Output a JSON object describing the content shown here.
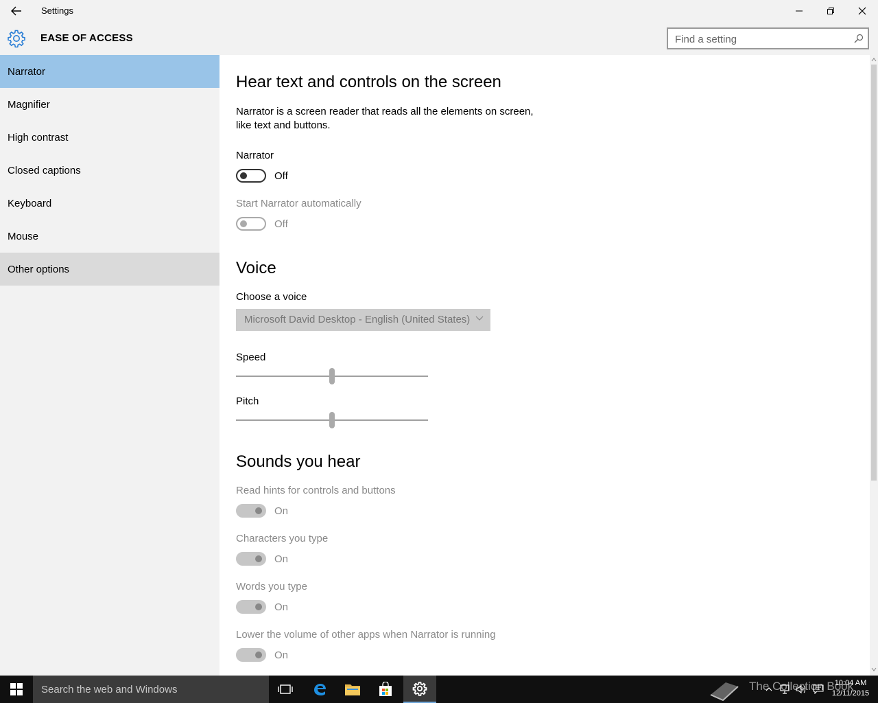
{
  "window": {
    "title": "Settings",
    "back_icon": "back-arrow-icon",
    "minimize_icon": "minimize-icon",
    "restore_icon": "restore-icon",
    "close_icon": "close-icon"
  },
  "header": {
    "icon": "gear-icon",
    "title": "EASE OF ACCESS",
    "search_placeholder": "Find a setting",
    "search_icon": "search-icon"
  },
  "sidebar": {
    "items": [
      {
        "label": "Narrator",
        "state": "selected"
      },
      {
        "label": "Magnifier",
        "state": "normal"
      },
      {
        "label": "High contrast",
        "state": "normal"
      },
      {
        "label": "Closed captions",
        "state": "normal"
      },
      {
        "label": "Keyboard",
        "state": "normal"
      },
      {
        "label": "Mouse",
        "state": "normal"
      },
      {
        "label": "Other options",
        "state": "hover"
      }
    ]
  },
  "main": {
    "heading1": "Hear text and controls on the screen",
    "description": "Narrator is a screen reader that reads all the elements on screen, like text and buttons.",
    "narrator": {
      "label": "Narrator",
      "value": "Off"
    },
    "start_auto": {
      "label": "Start Narrator automatically",
      "value": "Off"
    },
    "heading2": "Voice",
    "voice": {
      "label": "Choose a voice",
      "selected": "Microsoft David Desktop - English (United States)"
    },
    "speed": {
      "label": "Speed",
      "value_fraction": 0.5
    },
    "pitch": {
      "label": "Pitch",
      "value_fraction": 0.5
    },
    "heading3": "Sounds you hear",
    "sounds": [
      {
        "label": "Read hints for controls and buttons",
        "value": "On"
      },
      {
        "label": "Characters you type",
        "value": "On"
      },
      {
        "label": "Words you type",
        "value": "On"
      },
      {
        "label": "Lower the volume of other apps when Narrator is running",
        "value": "On"
      }
    ]
  },
  "taskbar": {
    "search_placeholder": "Search the web and Windows",
    "clock_time": "10:04 AM",
    "clock_date": "12/11/2015",
    "watermark": "The Collection Book",
    "accent": "#6ea6d9"
  },
  "colors": {
    "accent": "#0078d7",
    "sidebar_selected": "#99c4e8",
    "sidebar_hover": "#dadada"
  }
}
